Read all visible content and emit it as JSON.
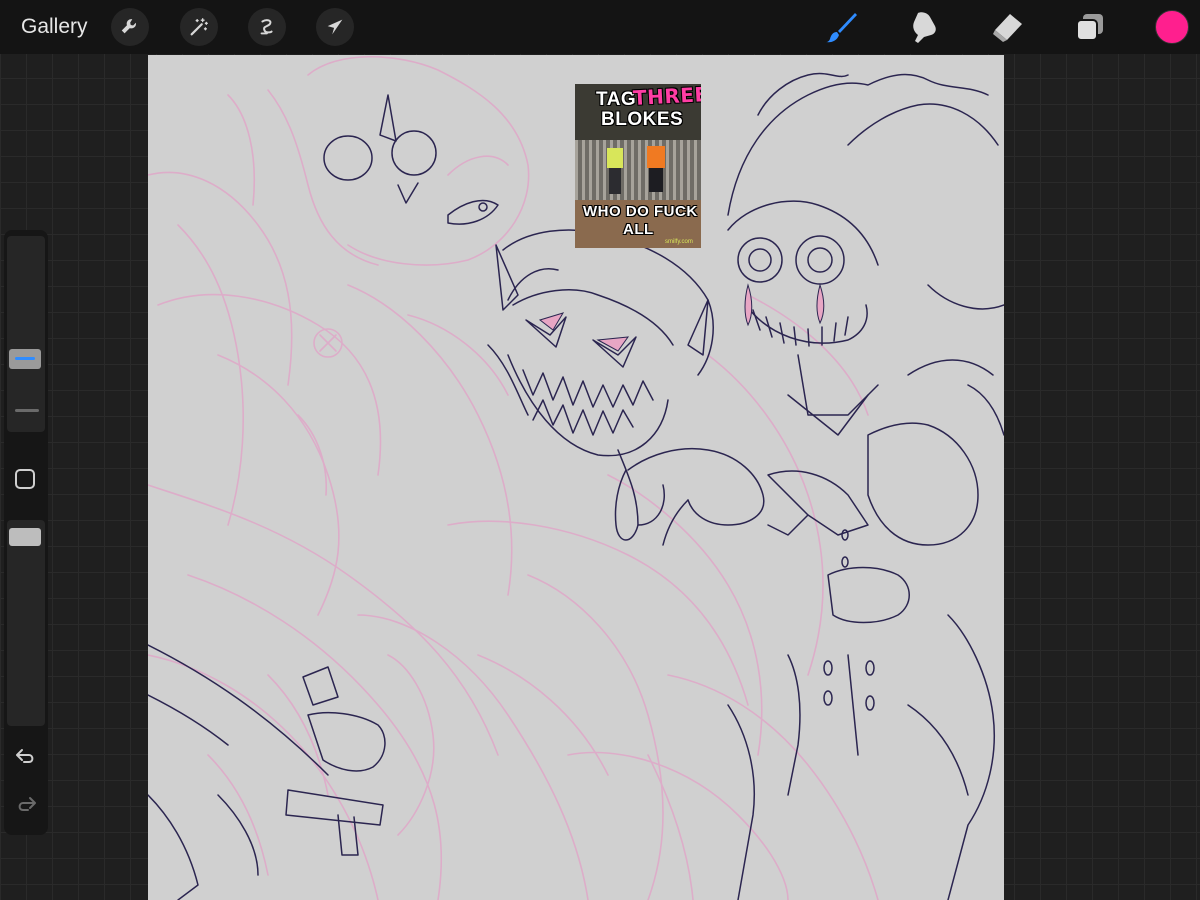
{
  "topbar": {
    "gallery_label": "Gallery",
    "left_tools": [
      "wrench-icon",
      "magic-wand-icon",
      "selection-icon",
      "transform-arrow-icon"
    ],
    "right_tools": [
      "brush-icon",
      "smudge-icon",
      "eraser-icon",
      "layers-icon"
    ],
    "active_tool": "brush-icon",
    "active_tool_color": "#2f8cff",
    "current_color": "#ff1f8e"
  },
  "sidebar": {
    "size_slider_handle_color": "#2f8cff",
    "icons": [
      "modify-square-icon",
      "undo-icon",
      "redo-icon"
    ]
  },
  "canvas": {
    "background": "#d0d0d0",
    "sketch_color": "#e0a7c8",
    "lineart_color": "#2b2550",
    "meme": {
      "line1_word1": "TAG",
      "line1_word2": "THREE",
      "line2": "BLOKES",
      "line3": "WHO DO FUCK",
      "line4": "ALL",
      "watermark": "smilfy.com",
      "accent_color": "#ff3da4"
    }
  }
}
